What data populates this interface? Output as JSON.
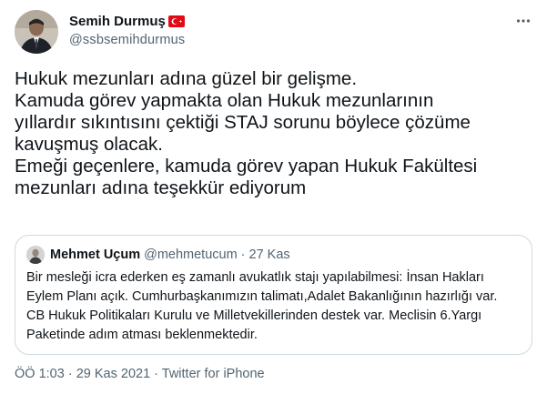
{
  "author": {
    "display_name": "Semih Durmuş",
    "handle": "@ssbsemihdurmus",
    "flag": "turkey-flag-icon"
  },
  "tweet": {
    "lines": [
      "Hukuk mezunları adına güzel bir gelişme.",
      "Kamuda görev yapmakta olan Hukuk mezunlarının",
      "yıllardır sıkıntısını çektiği STAJ sorunu böylece çözüme",
      "kavuşmuş olacak.",
      "Emeği geçenlere, kamuda görev yapan Hukuk Fakültesi",
      "mezunları adına teşekkür ediyorum"
    ]
  },
  "quote": {
    "display_name": "Mehmet Uçum",
    "handle": "@mehmetucum",
    "separator": "·",
    "time": "27 Kas",
    "lines": [
      "Bir mesleği icra ederken eş zamanlı avukatlık stajı yapılabilmesi: İnsan Hakları",
      "Eylem Planı açık. Cumhurbaşkanımızın talimatı,Adalet Bakanlığının hazırlığı var.",
      "CB Hukuk Politikaları Kurulu ve Milletvekillerinden destek var. Meclisin 6.Yargı",
      "Paketinde adım atması beklenmektedir."
    ]
  },
  "meta": {
    "time": "ÖÖ 1:03",
    "separator": "·",
    "date": "29 Kas 2021",
    "source": "Twitter for iPhone"
  },
  "colors": {
    "text": "#0f1419",
    "secondary": "#536471",
    "border": "#cfd9de",
    "flag_red": "#e30a17"
  }
}
